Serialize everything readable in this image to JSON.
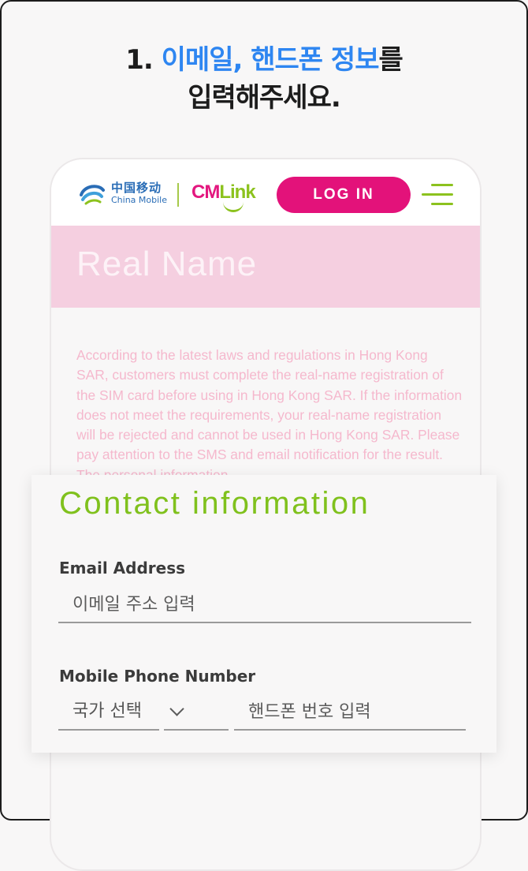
{
  "instruction": {
    "step": "1.",
    "highlight1": "이메일,",
    "highlight2": "핸드폰 정보",
    "suffix1": "를",
    "line2": "입력해주세요."
  },
  "header": {
    "brand_cn": "中国移动",
    "brand_en": "China Mobile",
    "cmlink_cm": "CM",
    "cmlink_link": "Link",
    "login_label": "LOG IN"
  },
  "banner": {
    "title": "Real Name"
  },
  "notice": {
    "text": "According to the latest laws and regulations in Hong Kong SAR, customers must complete the real-name registration of the SIM card before using in Hong Kong SAR. If the information does not meet the requirements, your real-name registration will be rejected and cannot be used in Hong Kong SAR. Please pay attention to the SMS and email notification for the result. The personal information"
  },
  "contact": {
    "title": "Contact information",
    "email_label": "Email Address",
    "email_placeholder": "이메일 주소 입력",
    "phone_label": "Mobile Phone Number",
    "country_value": "국가 선택",
    "phone_placeholder": "핸드폰 번호 입력"
  },
  "colors": {
    "accent_blue": "#2e86f1",
    "brand_pink": "#e3127a",
    "brand_green": "#8cc21e",
    "banner_pink": "#f5cfe0"
  }
}
